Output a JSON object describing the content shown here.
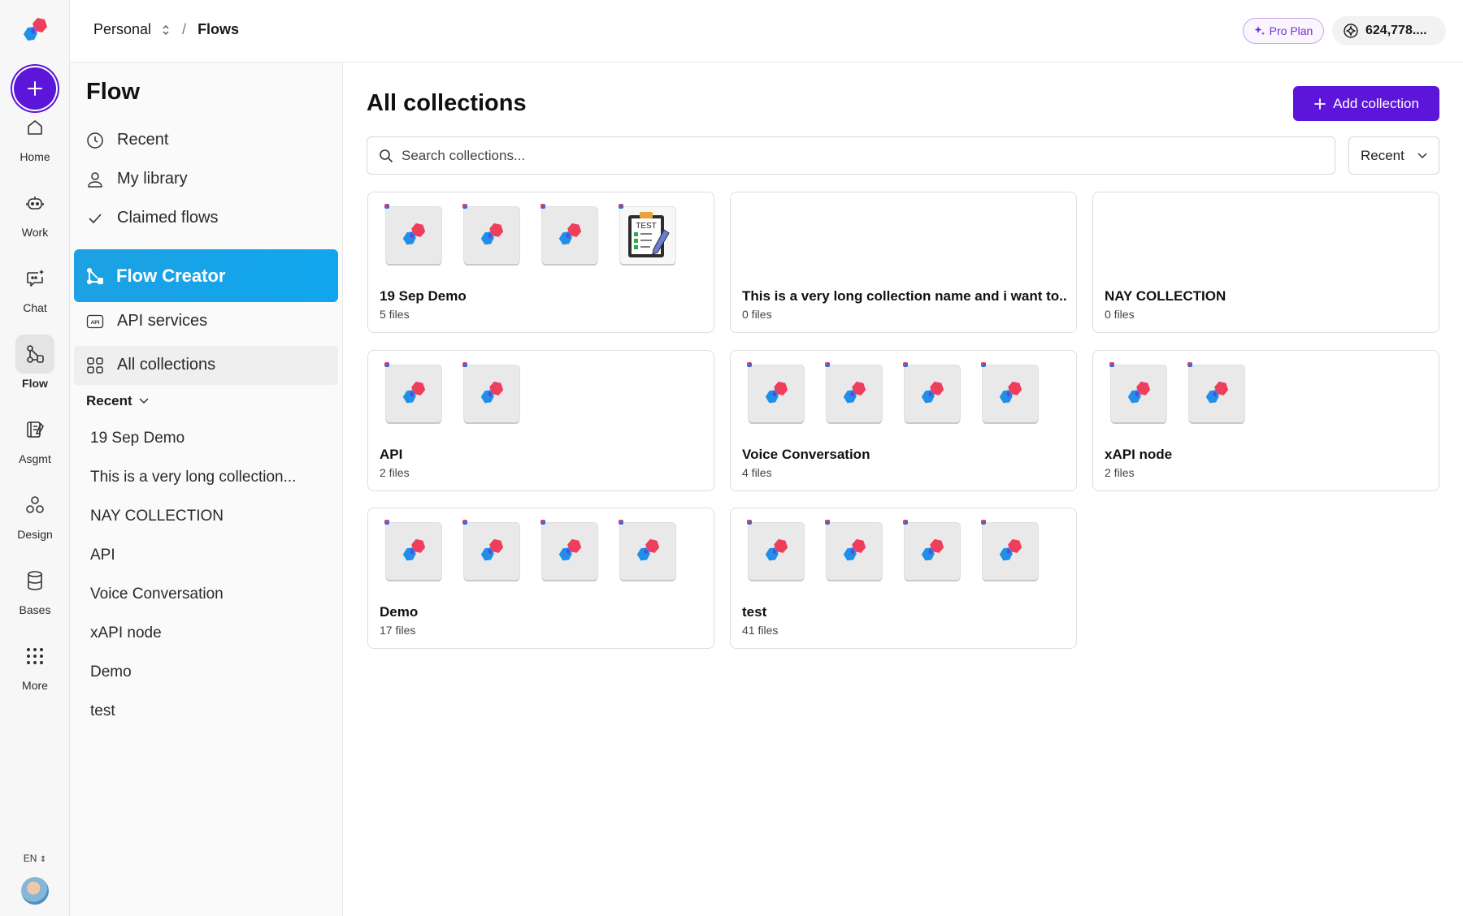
{
  "rail": {
    "items": [
      {
        "label": "Home",
        "icon": "home-icon"
      },
      {
        "label": "Work",
        "icon": "robot-icon"
      },
      {
        "label": "Chat",
        "icon": "chat-icon"
      },
      {
        "label": "Flow",
        "icon": "flow-icon"
      },
      {
        "label": "Asgmt",
        "icon": "assignment-icon"
      },
      {
        "label": "Design",
        "icon": "design-icon"
      },
      {
        "label": "Bases",
        "icon": "database-icon"
      },
      {
        "label": "More",
        "icon": "grid-dots-icon"
      }
    ],
    "active": "Flow",
    "lang": "EN"
  },
  "topbar": {
    "workspace": "Personal",
    "separator": "/",
    "page": "Flows",
    "plan": "Pro Plan",
    "credits": "624,778...."
  },
  "sidebar": {
    "title": "Flow",
    "links": [
      {
        "label": "Recent",
        "icon": "clock-icon"
      },
      {
        "label": "My library",
        "icon": "user-icon"
      },
      {
        "label": "Claimed flows",
        "icon": "check-icon"
      }
    ],
    "flow_creator": "Flow Creator",
    "sub_links": [
      {
        "label": "API services",
        "icon": "api-icon"
      },
      {
        "label": "All collections",
        "icon": "grid-icon"
      }
    ],
    "recent_label": "Recent",
    "recent_items": [
      "19 Sep Demo",
      "This is a very long collection...",
      "NAY COLLECTION",
      "API",
      "Voice Conversation",
      "xAPI node",
      "Demo",
      "test"
    ]
  },
  "main": {
    "title": "All collections",
    "add_button": "Add collection",
    "search_placeholder": "Search collections...",
    "sort_value": "Recent",
    "collections": [
      {
        "name": "19 Sep Demo",
        "count": "5 files",
        "thumbs": [
          "logo",
          "logo",
          "logo",
          "test"
        ]
      },
      {
        "name": "This is a very long collection name and i want to...",
        "count": "0 files",
        "thumbs": []
      },
      {
        "name": "NAY COLLECTION",
        "count": "0 files",
        "thumbs": []
      },
      {
        "name": "API",
        "count": "2 files",
        "thumbs": [
          "logo",
          "logo"
        ]
      },
      {
        "name": "Voice Conversation",
        "count": "4 files",
        "thumbs": [
          "logo",
          "logo",
          "logo",
          "logo"
        ]
      },
      {
        "name": "xAPI node",
        "count": "2 files",
        "thumbs": [
          "logo",
          "logo"
        ]
      },
      {
        "name": "Demo",
        "count": "17 files",
        "thumbs": [
          "logo",
          "logo",
          "logo",
          "logo"
        ]
      },
      {
        "name": "test",
        "count": "41 files",
        "thumbs": [
          "logo",
          "logo",
          "logo",
          "logo"
        ]
      }
    ],
    "thumb_test_text": "TEST"
  },
  "colors": {
    "accent": "#5b16d9",
    "flow_creator": "#10a6ee",
    "logo_red": "#ef3d5c",
    "logo_blue": "#1f8fe8"
  }
}
